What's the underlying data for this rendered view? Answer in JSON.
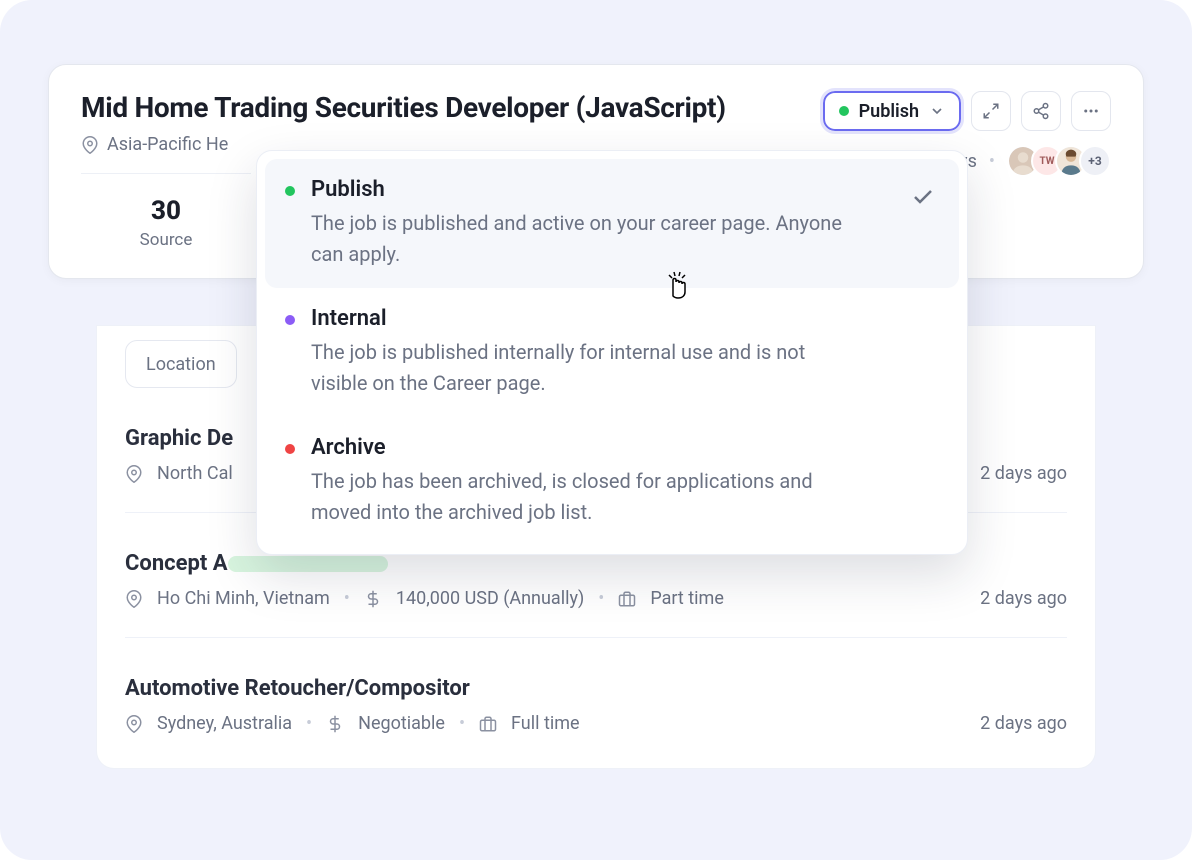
{
  "header": {
    "title": "Mid Home Trading Securities Developer (JavaScript)",
    "location_fragment": "Asia-Pacific He",
    "publish_btn_label": "Publish",
    "views_suffix": "vs",
    "avatar_tw": "TW",
    "avatar_more": "+3"
  },
  "stat": {
    "value": "30",
    "label": "Source"
  },
  "dropdown": {
    "items": [
      {
        "title": "Publish",
        "desc": "The job is published and active on your career page. Anyone can apply."
      },
      {
        "title": "Internal",
        "desc": "The job is published internally for internal use and is not visible on the Career page."
      },
      {
        "title": "Archive",
        "desc": "The job has been archived, is closed for applications and moved into the archived job list."
      }
    ]
  },
  "filters": {
    "location_label": "Location"
  },
  "jobs": [
    {
      "title": "Graphic De",
      "location": "North Cal",
      "salary": "",
      "type": "",
      "ago": "2 days ago"
    },
    {
      "title": "Concept A",
      "location": "Ho Chi Minh, Vietnam",
      "salary": "140,000 USD (Annually)",
      "type": "Part time",
      "ago": "2 days ago"
    },
    {
      "title": "Automotive Retoucher/Compositor",
      "location": "Sydney, Australia",
      "salary": "Negotiable",
      "type": "Full time",
      "ago": "2 days ago"
    }
  ]
}
